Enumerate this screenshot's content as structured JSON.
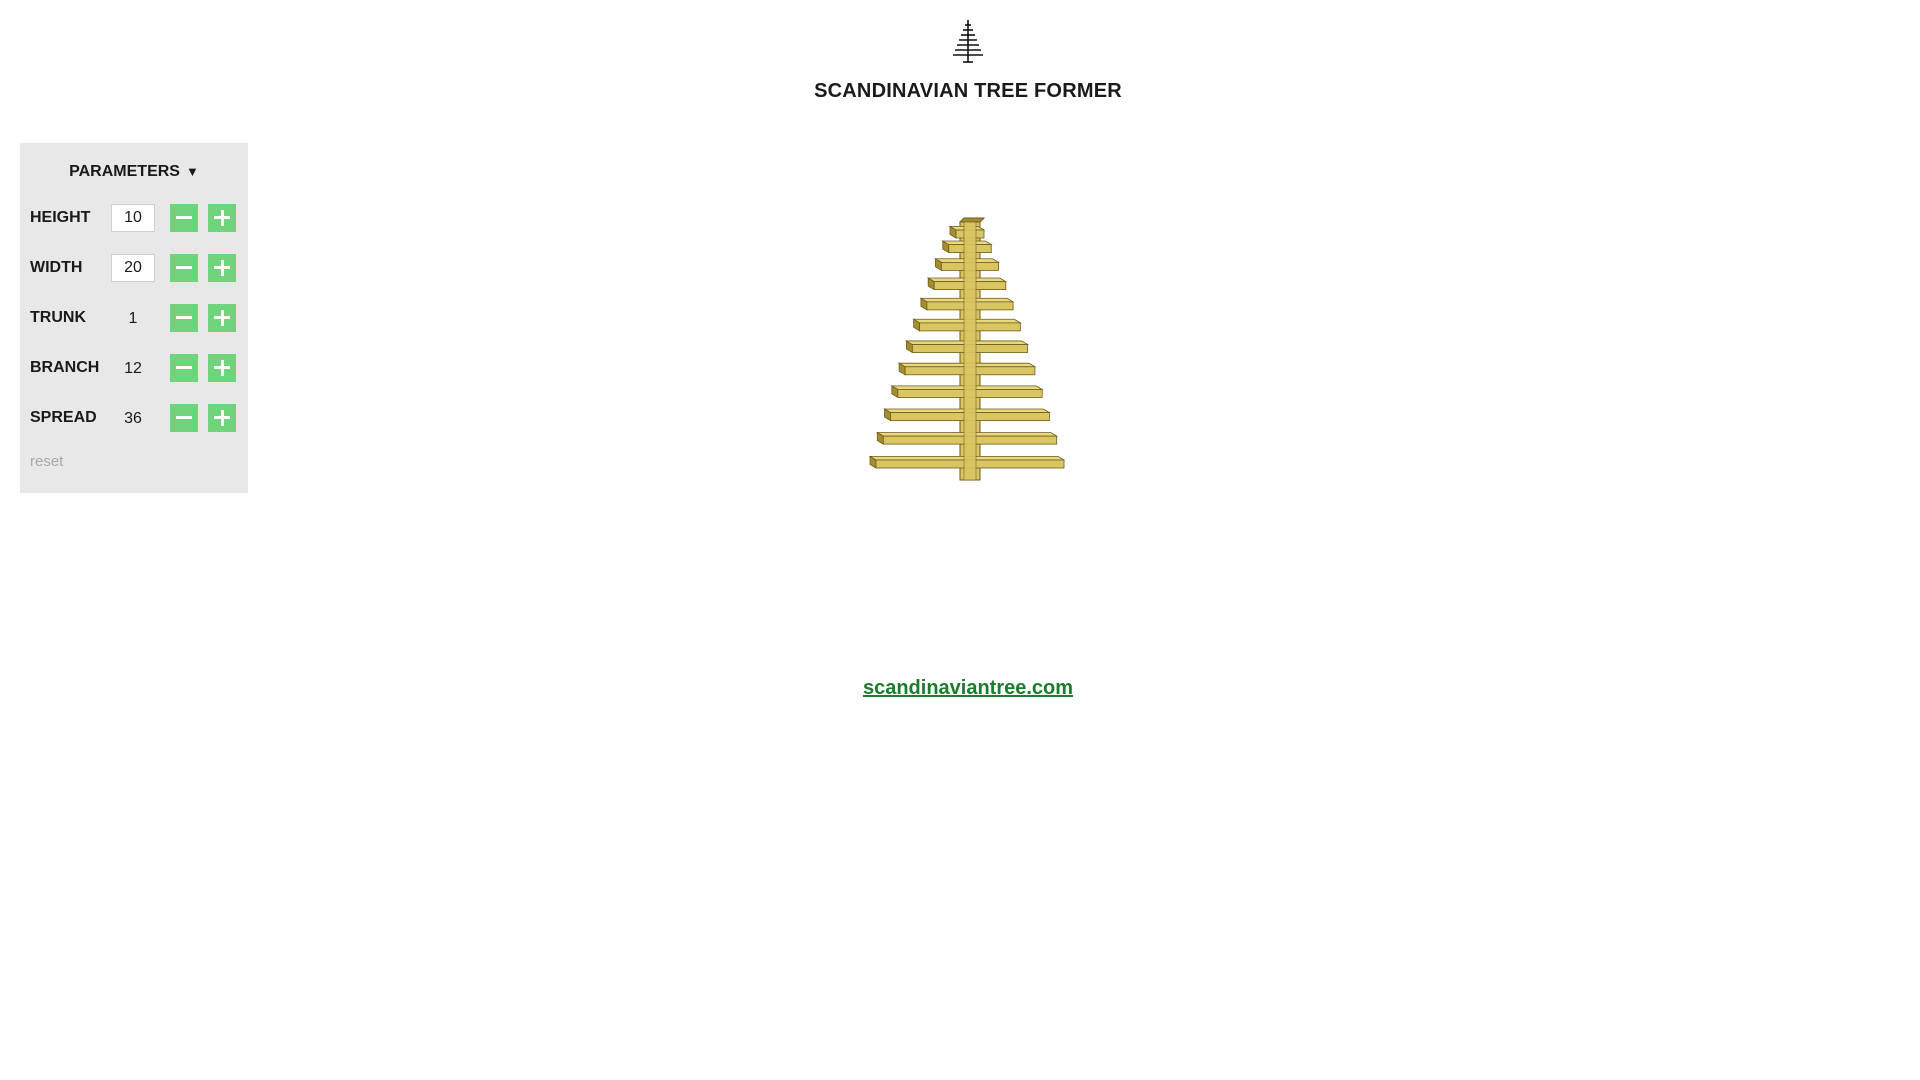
{
  "app": {
    "title": "SCANDINAVIAN TREE FORMER",
    "logo_icon": "tree-logo-icon"
  },
  "parameters": {
    "header": "PARAMETERS",
    "toggle_glyph": "▼",
    "rows": [
      {
        "label": "HEIGHT",
        "value": "10",
        "editable": true
      },
      {
        "label": "WIDTH",
        "value": "20",
        "editable": true
      },
      {
        "label": "TRUNK",
        "value": "1",
        "editable": false
      },
      {
        "label": "BRANCH",
        "value": "12",
        "editable": false
      },
      {
        "label": "SPREAD",
        "value": "36",
        "editable": false
      }
    ],
    "reset_label": "reset",
    "button_color": "#6fd47c"
  },
  "preview": {
    "branch_count": 12,
    "wood_color": "#d9c562",
    "wood_side_color": "#a38f2f",
    "outline_color": "#6b5d1d"
  },
  "footer": {
    "link_text": "scandinaviantree.com",
    "link_color": "#1e7a2e"
  }
}
